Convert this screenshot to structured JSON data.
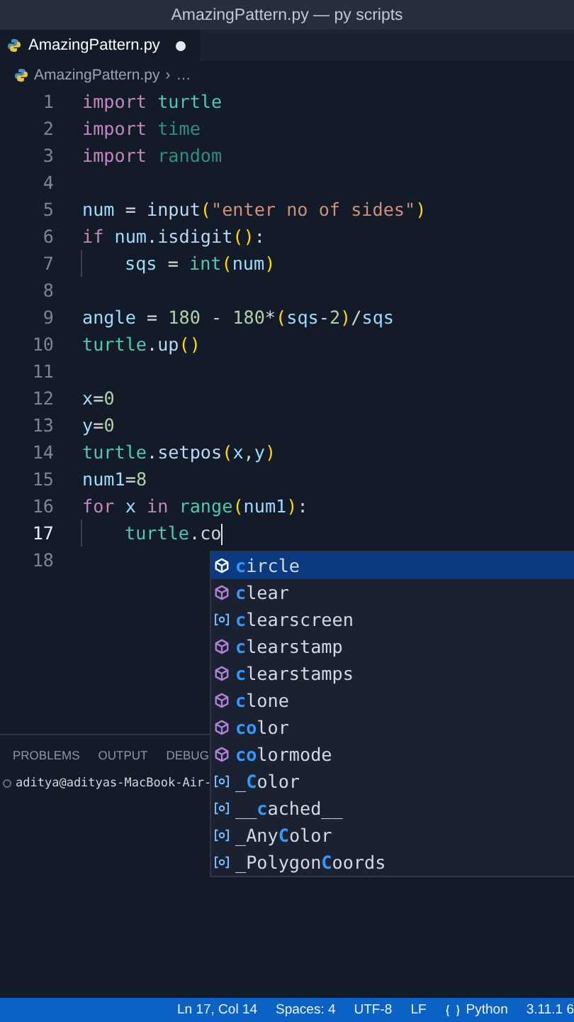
{
  "window": {
    "title": "AmazingPattern.py — py scripts"
  },
  "tabs": [
    {
      "label": "AmazingPattern.py",
      "selected": true,
      "modified": true
    }
  ],
  "breadcrumb": {
    "file": "AmazingPattern.py",
    "separator": "›",
    "more": "…"
  },
  "editor": {
    "lines": [
      {
        "number": "1",
        "current": false,
        "indented": false,
        "tokens": [
          {
            "kind": "keyword",
            "text": "import "
          },
          {
            "kind": "module",
            "text": "turtle"
          }
        ]
      },
      {
        "number": "2",
        "current": false,
        "indented": false,
        "tokens": [
          {
            "kind": "keyword",
            "text": "import "
          },
          {
            "kind": "faded",
            "text": "time"
          }
        ]
      },
      {
        "number": "3",
        "current": false,
        "indented": false,
        "tokens": [
          {
            "kind": "keyword",
            "text": "import "
          },
          {
            "kind": "faded",
            "text": "random"
          }
        ]
      },
      {
        "number": "4",
        "current": false,
        "indented": false
      },
      {
        "number": "5",
        "current": false,
        "indented": false,
        "tokens": [
          {
            "kind": "variable",
            "text": "num"
          },
          {
            "kind": "plain",
            "text": " = "
          },
          {
            "kind": "func",
            "text": "input"
          },
          {
            "kind": "paren",
            "text": "("
          },
          {
            "kind": "string",
            "text": "\"enter no of sides\""
          },
          {
            "kind": "paren",
            "text": ")"
          }
        ]
      },
      {
        "number": "6",
        "current": false,
        "indented": false,
        "tokens": [
          {
            "kind": "keyword",
            "text": "if "
          },
          {
            "kind": "variable",
            "text": "num"
          },
          {
            "kind": "plain",
            "text": "."
          },
          {
            "kind": "func",
            "text": "isdigit"
          },
          {
            "kind": "paren",
            "text": "()"
          },
          {
            "kind": "plain",
            "text": ":"
          }
        ]
      },
      {
        "number": "7",
        "current": false,
        "indented": true,
        "tokens": [
          {
            "kind": "variable",
            "text": "sqs"
          },
          {
            "kind": "plain",
            "text": " = "
          },
          {
            "kind": "builtin",
            "text": "int"
          },
          {
            "kind": "paren",
            "text": "("
          },
          {
            "kind": "variable",
            "text": "num"
          },
          {
            "kind": "paren",
            "text": ")"
          }
        ]
      },
      {
        "number": "8",
        "current": false,
        "indented": false
      },
      {
        "number": "9",
        "current": false,
        "indented": false,
        "tokens": [
          {
            "kind": "variable",
            "text": "angle"
          },
          {
            "kind": "plain",
            "text": " = "
          },
          {
            "kind": "number",
            "text": "180"
          },
          {
            "kind": "plain",
            "text": " - "
          },
          {
            "kind": "number",
            "text": "180"
          },
          {
            "kind": "plain",
            "text": "*"
          },
          {
            "kind": "paren",
            "text": "("
          },
          {
            "kind": "variable",
            "text": "sqs"
          },
          {
            "kind": "plain",
            "text": "-"
          },
          {
            "kind": "number",
            "text": "2"
          },
          {
            "kind": "paren",
            "text": ")"
          },
          {
            "kind": "plain",
            "text": "/"
          },
          {
            "kind": "variable",
            "text": "sqs"
          }
        ]
      },
      {
        "number": "10",
        "current": false,
        "indented": false,
        "tokens": [
          {
            "kind": "module",
            "text": "turtle"
          },
          {
            "kind": "plain",
            "text": "."
          },
          {
            "kind": "func",
            "text": "up"
          },
          {
            "kind": "paren",
            "text": "()"
          }
        ]
      },
      {
        "number": "11",
        "current": false,
        "indented": false
      },
      {
        "number": "12",
        "current": false,
        "indented": false,
        "tokens": [
          {
            "kind": "variable",
            "text": "x"
          },
          {
            "kind": "plain",
            "text": "="
          },
          {
            "kind": "number",
            "text": "0"
          }
        ]
      },
      {
        "number": "13",
        "current": false,
        "indented": false,
        "tokens": [
          {
            "kind": "variable",
            "text": "y"
          },
          {
            "kind": "plain",
            "text": "="
          },
          {
            "kind": "number",
            "text": "0"
          }
        ]
      },
      {
        "number": "14",
        "current": false,
        "indented": false,
        "tokens": [
          {
            "kind": "module",
            "text": "turtle"
          },
          {
            "kind": "plain",
            "text": "."
          },
          {
            "kind": "func",
            "text": "setpos"
          },
          {
            "kind": "paren",
            "text": "("
          },
          {
            "kind": "variable",
            "text": "x"
          },
          {
            "kind": "plain",
            "text": ","
          },
          {
            "kind": "variable",
            "text": "y"
          },
          {
            "kind": "paren",
            "text": ")"
          }
        ]
      },
      {
        "number": "15",
        "current": false,
        "indented": false,
        "tokens": [
          {
            "kind": "variable",
            "text": "num1"
          },
          {
            "kind": "plain",
            "text": "="
          },
          {
            "kind": "number",
            "text": "8"
          }
        ]
      },
      {
        "number": "16",
        "current": false,
        "indented": false,
        "tokens": [
          {
            "kind": "keyword",
            "text": "for "
          },
          {
            "kind": "variable",
            "text": "x "
          },
          {
            "kind": "keyword",
            "text": "in "
          },
          {
            "kind": "builtin",
            "text": "range"
          },
          {
            "kind": "paren",
            "text": "("
          },
          {
            "kind": "variable",
            "text": "num1"
          },
          {
            "kind": "paren",
            "text": ")"
          },
          {
            "kind": "plain",
            "text": ":"
          }
        ]
      },
      {
        "number": "17",
        "current": true,
        "indented": true,
        "tokens": [
          {
            "kind": "module",
            "text": "turtle"
          },
          {
            "kind": "plain",
            "text": "."
          },
          {
            "kind": "plain",
            "text": "co"
          }
        ]
      },
      {
        "number": "18",
        "current": false,
        "indented": false
      }
    ]
  },
  "suggestions": [
    {
      "kind": "method",
      "selected": true,
      "match": "c",
      "after": "ircle"
    },
    {
      "kind": "method",
      "selected": false,
      "match": "c",
      "after": "lear"
    },
    {
      "kind": "variable",
      "selected": false,
      "match": "c",
      "after": "learscreen"
    },
    {
      "kind": "method",
      "selected": false,
      "match": "c",
      "after": "learstamp"
    },
    {
      "kind": "method",
      "selected": false,
      "match": "c",
      "after": "learstamps"
    },
    {
      "kind": "method",
      "selected": false,
      "match": "c",
      "after": "lone"
    },
    {
      "kind": "method",
      "selected": false,
      "match": "co",
      "after": "lor"
    },
    {
      "kind": "method",
      "selected": false,
      "match": "co",
      "after": "lormode"
    },
    {
      "kind": "variable",
      "selected": false,
      "before": "_",
      "match": "C",
      "after": "olor"
    },
    {
      "kind": "variable",
      "selected": false,
      "before": "__",
      "match": "c",
      "after": "ached__"
    },
    {
      "kind": "variable",
      "selected": false,
      "before": "_Any",
      "match": "C",
      "after": "olor"
    },
    {
      "kind": "variable",
      "selected": false,
      "before": "_Polygon",
      "match": "C",
      "after": "oords"
    }
  ],
  "panel": {
    "tabs": [
      {
        "label": "PROBLEMS",
        "selected": false
      },
      {
        "label": "OUTPUT",
        "selected": false
      },
      {
        "label": "DEBUG",
        "selected": false
      }
    ],
    "terminal_line": "aditya@adityas-MacBook-Air-"
  },
  "status_bar": {
    "items": [
      {
        "kind": "text",
        "text": "Ln 17, Col 14"
      },
      {
        "kind": "text",
        "text": "Spaces: 4"
      },
      {
        "kind": "text",
        "text": "UTF-8"
      },
      {
        "kind": "text",
        "text": "LF"
      },
      {
        "kind": "language",
        "text": "Python"
      },
      {
        "kind": "text",
        "text": "3.11.1 6"
      }
    ]
  }
}
